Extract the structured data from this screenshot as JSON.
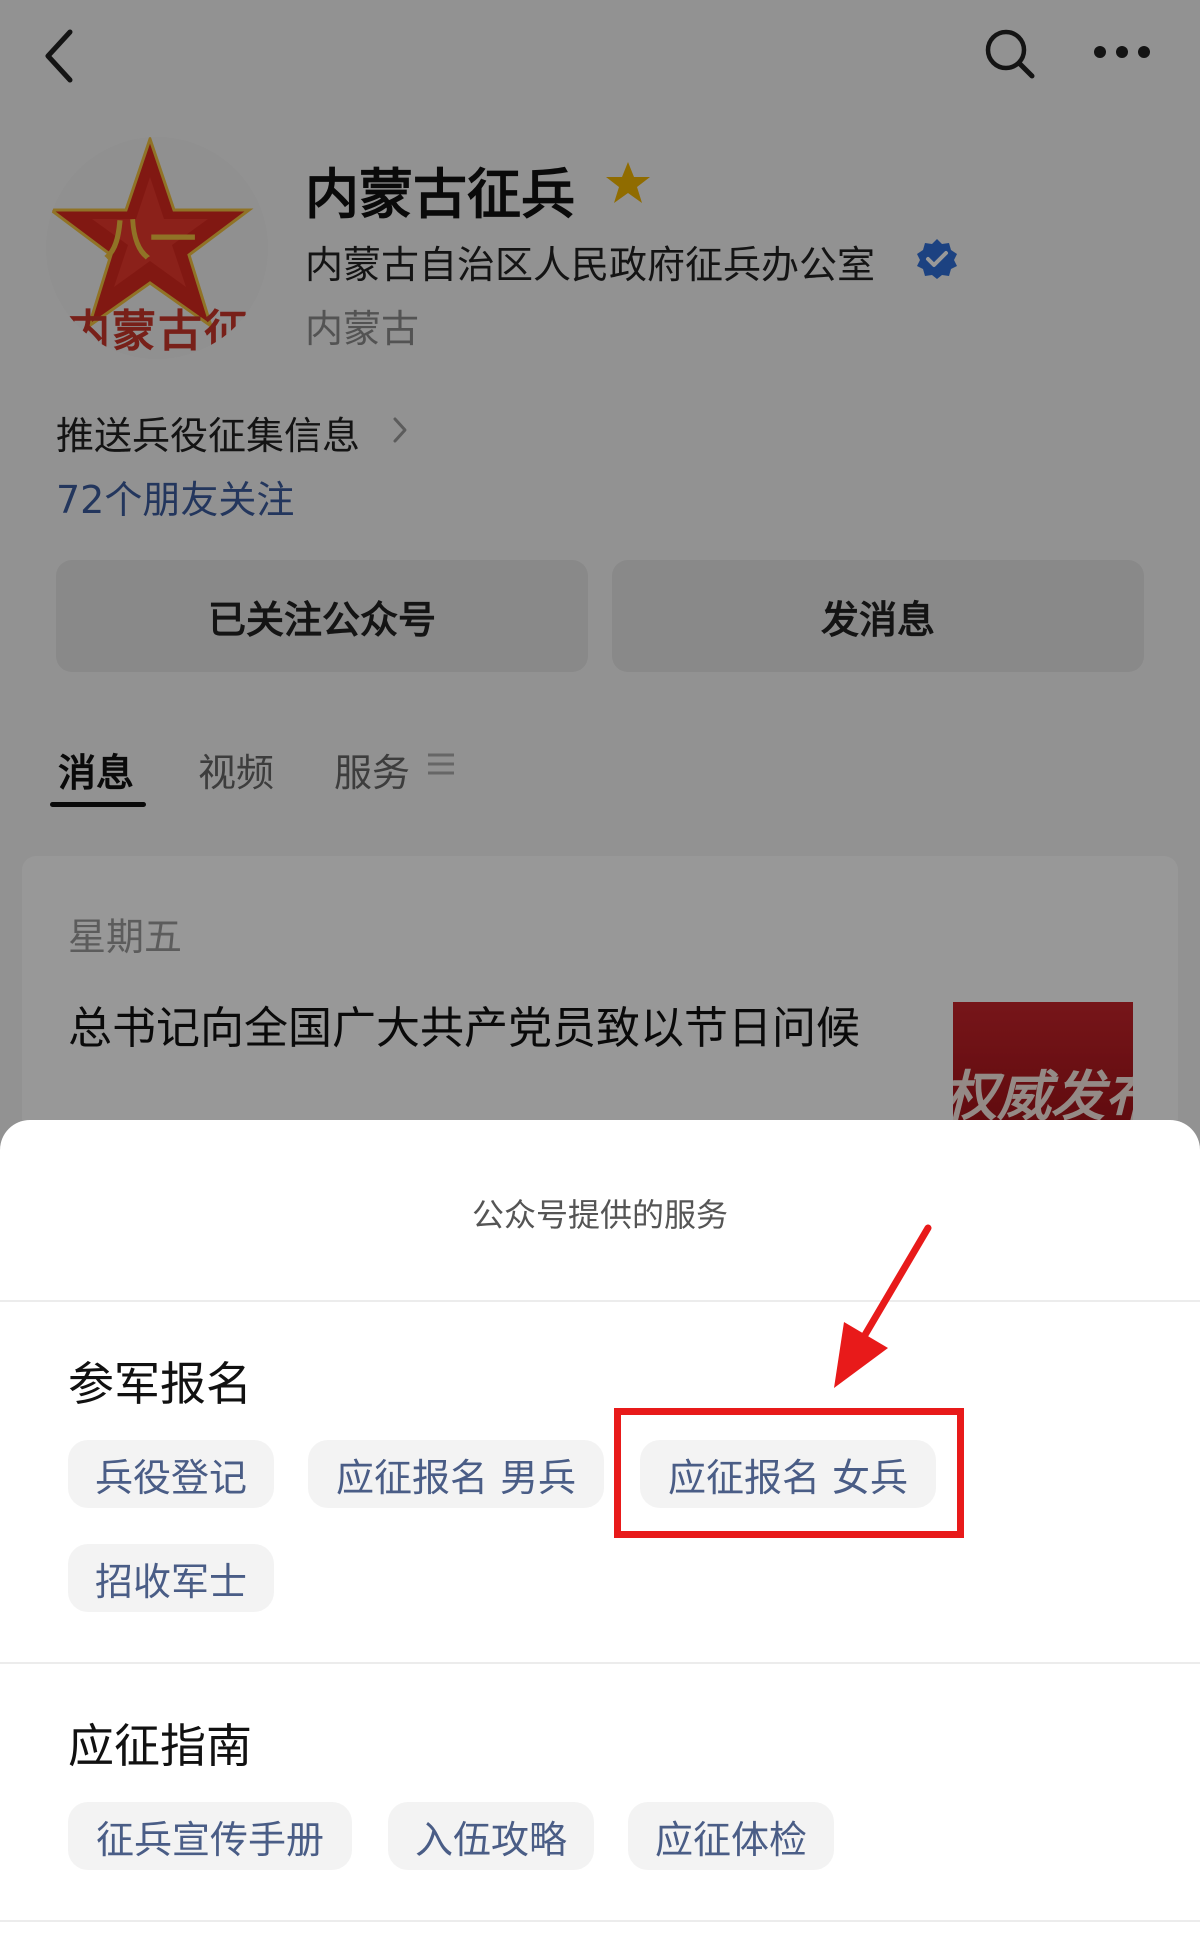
{
  "account": {
    "name": "内蒙古征兵",
    "organization": "内蒙古自治区人民政府征兵办公室",
    "region": "内蒙古",
    "avatar_text": "内蒙古征兵",
    "description": "推送兵役征集信息",
    "friends_following": "72个朋友关注"
  },
  "actions": {
    "followed_label": "已关注公众号",
    "message_label": "发消息"
  },
  "tabs": [
    {
      "label": "消息",
      "active": true
    },
    {
      "label": "视频",
      "active": false
    },
    {
      "label": "服务",
      "active": false
    }
  ],
  "messages": [
    {
      "day": "星期五",
      "title": "总书记向全国广大共产党员致以节日问候",
      "thumb_text": "权威发布"
    }
  ],
  "sheet": {
    "title": "公众号提供的服务",
    "sections": [
      {
        "title": "参军报名",
        "items": [
          "兵役登记",
          "应征报名 男兵",
          "应征报名 女兵",
          "招收军士"
        ]
      },
      {
        "title": "应征指南",
        "items": [
          "征兵宣传手册",
          "入伍攻略",
          "应征体检"
        ]
      }
    ],
    "highlighted_item": "应征报名 女兵"
  },
  "icons": {
    "back": "back-icon",
    "search": "search-icon",
    "more": "more-icon",
    "star": "star-badge-icon",
    "verified": "verified-icon"
  },
  "colors": {
    "link": "#3b5b9c",
    "chip_text": "#4a5d86",
    "highlight": "#e81a1a",
    "star": "#f0b400",
    "verified": "#2f6fd8"
  }
}
